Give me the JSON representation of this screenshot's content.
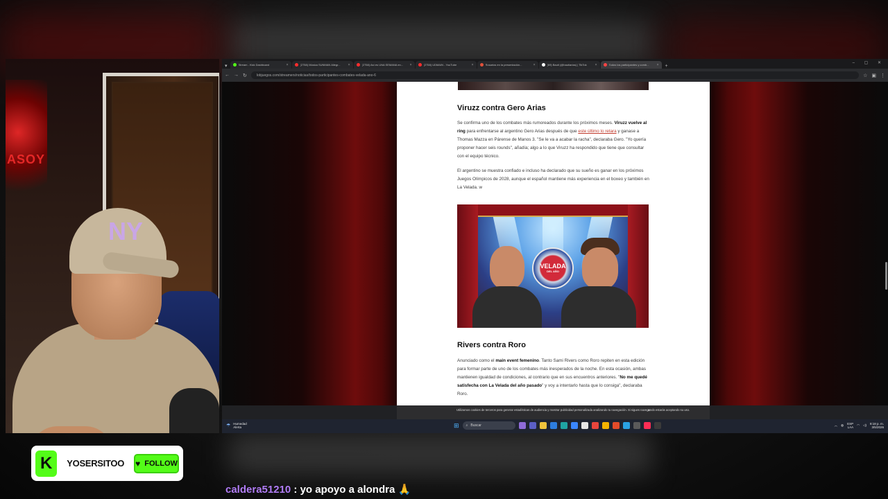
{
  "stream": {
    "channel_name": "YOSERSITOO",
    "follow_label": "FOLLOW",
    "kick_logo": "K",
    "brand_color": "#53fc18",
    "webcam_sign_text": "ASOY",
    "cap_logo": "NY"
  },
  "chat": {
    "username": "caldera51210",
    "separator": ":",
    "message": "yo apoyo a alondra 🙏"
  },
  "browser": {
    "tabs": [
      {
        "title": "Stream - Kick Dashboard",
        "color": "#53fc18",
        "active": false
      },
      {
        "title": "(2758) Música SUNMAN Allegr...",
        "color": "#ff2d2d",
        "active": false
      },
      {
        "title": "(2758) Así es UNA SEMANA en...",
        "color": "#ff2d2d",
        "active": false
      },
      {
        "title": "(2758) UDMAIN - YouTube",
        "color": "#ff2d2d",
        "active": false
      },
      {
        "title": "Rosarios en la presentación...",
        "color": "#e0513a",
        "active": false
      },
      {
        "title": "(69) Bauti (@bautiarias) | TikTok",
        "color": "#ffffff",
        "active": false
      },
      {
        "title": "Todos los participantes y comb...",
        "color": "#ff4444",
        "active": true
      }
    ],
    "url": "lobjuegos.com/streamers/noticias/todos-participantes-combates-velada-ano-6"
  },
  "article": {
    "section1_title": "Viruzz contra Gero Arias",
    "p1_a": "Se confirma uno de los combates más rumoreados durante los próximos meses.",
    "p1_bold": "Viruzz vuelve al ring",
    "p1_b": " para enfrentarse al argentino Gero Arias después de que",
    "p1_link": "este último lo retara",
    "p1_c": " y ganase a Thomas Mazza en Párense de Manos 3. \"Se le va a acabar la racha\", declaraba Gero. \"Yo quería proponer hacer seis rounds\", añadía; algo a lo que Viruzz ha respondido que tiene que consultar con el equipo técnico.",
    "p2": "El argentino se muestra confiado e incluso ha declarado que su sueño es ganar en los próximos Juegos Olímpicos de 2028, aunque el español mantiene más experiencia en el boxeo y también en La Velada. w",
    "hero_seal_title": "VELADA",
    "hero_seal_sub": "DEL AÑO",
    "section2_title": "Rivers contra Roro",
    "p3_a": "Anunciado como el ",
    "p3_bold1": "main event femenino",
    "p3_b": ". Tanto Sami Rivers como Roro repiten en esta edición para formar parte de uno de los combates más inesperados de la noche. En esta ocasión, ambas mantienen igualdad de condiciones, al contrario que en sus encuentros anteriores. \"",
    "p3_bold2": "No me quedé satisfecha con La Velada del año pasado",
    "p3_c": "\" y voy a intentarlo hasta que lo consiga\", declaraba Roro."
  },
  "cookie_banner": {
    "text": "Utilizamos cookies de terceros para generar estadísticas de audiencia y mostrar publicidad personalizada analizando tu navegación. Si sigues navegando estarás aceptando su uso.",
    "close": "×"
  },
  "taskbar": {
    "weather_title": "Humedad",
    "weather_sub": "Alerta",
    "search_placeholder": "Buscar",
    "lang": "ESP",
    "lang_sub": "LAA",
    "time": "8:18 p. m.",
    "date": "3/5/2026"
  }
}
